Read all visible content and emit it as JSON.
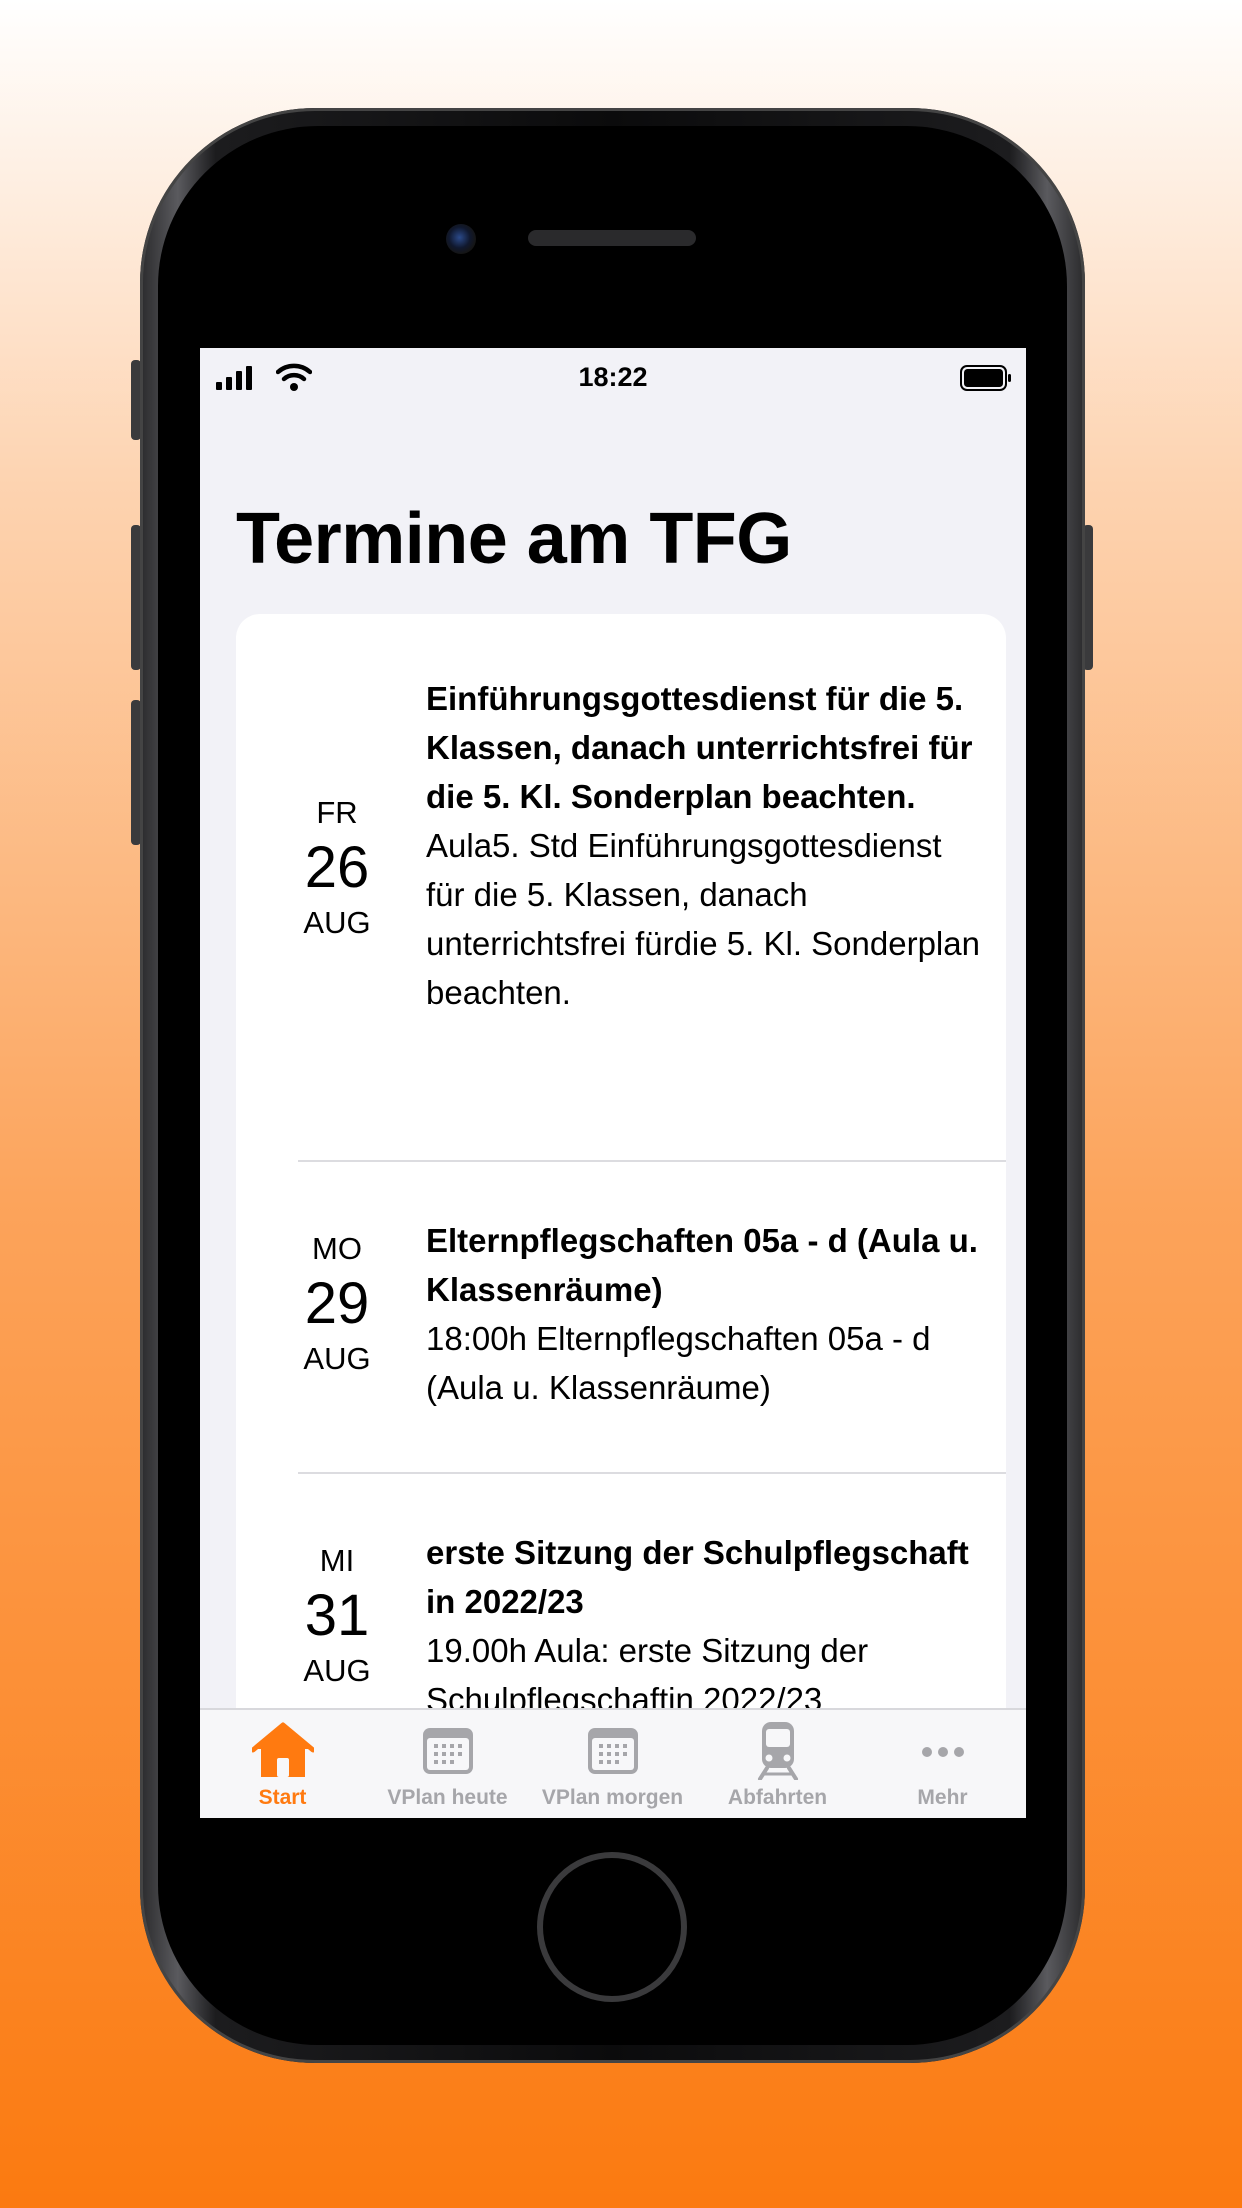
{
  "status_bar": {
    "time": "18:22"
  },
  "page": {
    "title": "Termine am TFG"
  },
  "events": [
    {
      "dow": "FR",
      "day": "26",
      "month": "AUG",
      "title": "Einführungsgottesdienst für die 5. Klassen, danach unterrichtsfrei für die 5. Kl. Sonderplan beachten.",
      "description": "Aula5. Std Einführungsgottesdienst für die 5. Klassen, danach unterrichtsfrei fürdie 5. Kl. Sonderplan beachten."
    },
    {
      "dow": "MO",
      "day": "29",
      "month": "AUG",
      "title": "Elternpflegschaften 05a - d (Aula u. Klassenräume)",
      "description": "18:00h Elternpflegschaften 05a - d (Aula u. Klassenräume)"
    },
    {
      "dow": "MI",
      "day": "31",
      "month": "AUG",
      "title": "erste Sitzung der Schulpflegschaft in 2022/23",
      "description": "19.00h Aula: erste Sitzung der Schulpflegschaftin 2022/23"
    }
  ],
  "tab_bar": {
    "tabs": [
      {
        "label": "Start",
        "icon": "house-icon",
        "active": true
      },
      {
        "label": "VPlan heute",
        "icon": "calendar-icon",
        "active": false
      },
      {
        "label": "VPlan morgen",
        "icon": "calendar-icon",
        "active": false
      },
      {
        "label": "Abfahrten",
        "icon": "tram-icon",
        "active": false
      },
      {
        "label": "Mehr",
        "icon": "more-icon",
        "active": false
      }
    ]
  },
  "colors": {
    "accent": "#ff7a10",
    "inactive_tab": "#a6a6aa",
    "background_gradient_bottom": "#fb7a10"
  }
}
